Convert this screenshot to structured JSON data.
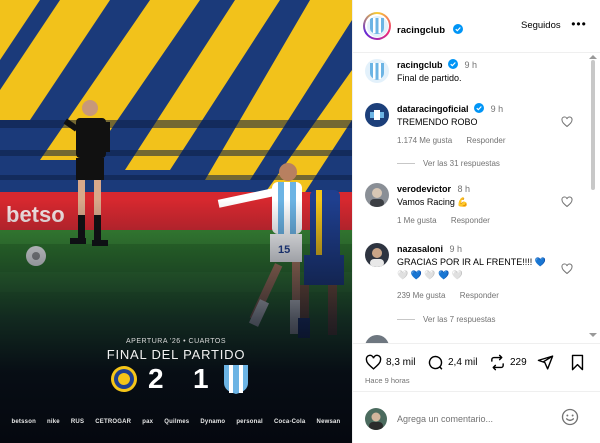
{
  "post": {
    "match_round": "APERTURA '26 • CUARTOS",
    "result_title": "FINAL DEL PARTIDO",
    "home_goals": "2",
    "away_goals": "1",
    "sponsors": [
      "betsson",
      "nike",
      "RUS",
      "CETROGAR",
      "pax",
      "Quilmes",
      "Dynamo",
      "personal",
      "Coca-Cola",
      "Newsan"
    ]
  },
  "header": {
    "username": "racingclub",
    "follow_label": "Seguidos",
    "more_label": "•••"
  },
  "caption": {
    "username": "racingclub",
    "time": "9 h",
    "text": "Final de partido."
  },
  "comments": [
    {
      "username": "dataracingoficial",
      "verified": true,
      "time": "9 h",
      "text": "TREMENDO ROBO",
      "likes": "1.174 Me gusta",
      "reply_label": "Responder",
      "view_replies": "Ver las 31 respuestas"
    },
    {
      "username": "verodevictor",
      "verified": false,
      "time": "8 h",
      "text": "Vamos Racing 💪",
      "likes": "1 Me gusta",
      "reply_label": "Responder"
    },
    {
      "username": "nazasaloni",
      "verified": false,
      "time": "9 h",
      "text": "GRACIAS POR IR AL FRENTE!!!! 💙",
      "text2": "🤍 💙 🤍 💙 🤍",
      "likes": "239 Me gusta",
      "reply_label": "Responder",
      "view_replies": "Ver las 7 respuestas"
    }
  ],
  "actions": {
    "likes": "8,3 mil",
    "comments": "2,4 mil",
    "reposts": "229",
    "posted_ago": "Hace 9 horas"
  },
  "composer": {
    "placeholder": "Agrega un comentario..."
  },
  "colors": {
    "racing_blue": "#6cb4e4",
    "rosario_blue": "#1f3f8f",
    "rosario_yellow": "#f5c518",
    "verified_blue": "#0095f6",
    "meta_gray": "#737373"
  },
  "icons": [
    "verified-icon",
    "more-icon",
    "heart-icon",
    "comment-icon",
    "repost-icon",
    "share-icon",
    "bookmark-icon",
    "emoji-icon"
  ]
}
